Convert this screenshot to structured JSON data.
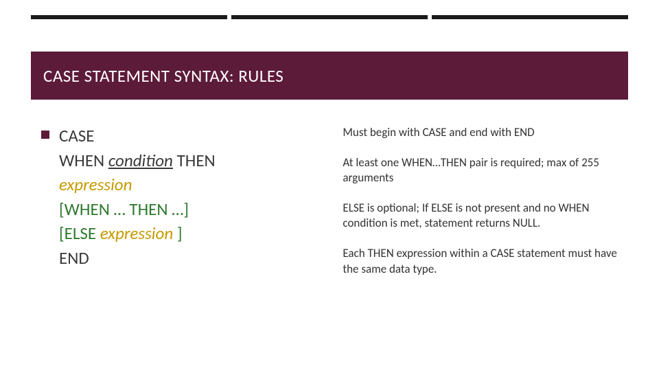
{
  "title": "CASE STATEMENT SYNTAX: RULES",
  "syntax": {
    "case": "CASE",
    "when": "WHEN ",
    "condition": "condition",
    "then": "   THEN",
    "expression1": "expression",
    "optional_when": "[WHEN … THEN …]",
    "else_open": "[ELSE ",
    "else_expr": "expression",
    "else_close": "  ]",
    "end": "END"
  },
  "rules": {
    "r1": "Must begin with CASE and end with END",
    "r2": "At least one WHEN…THEN pair is required; max of 255 arguments",
    "r3": "ELSE is optional; If ELSE is not present and no WHEN condition is met, statement returns NULL.",
    "r4": "Each THEN expression within a CASE statement must have the same data type."
  }
}
